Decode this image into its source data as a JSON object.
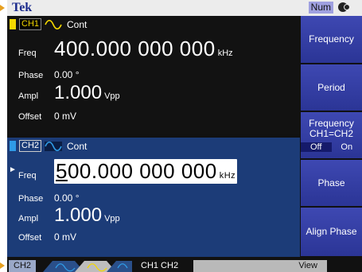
{
  "brand": "Tek",
  "num_indicator": "Num",
  "colors": {
    "ch1": "#f5d800",
    "ch2": "#2f9be6",
    "softkey": "#3a45b0"
  },
  "ch1": {
    "tag": "CH1",
    "mode": "Cont",
    "freq": {
      "label": "Freq",
      "value": "400.000 000 000",
      "unit": "kHz"
    },
    "phase": {
      "label": "Phase",
      "value": "0.00 °"
    },
    "ampl": {
      "label": "Ampl",
      "value": "1.000",
      "unit": "Vpp"
    },
    "offset": {
      "label": "Offset",
      "value": "0 mV"
    }
  },
  "ch2": {
    "tag": "CH2",
    "mode": "Cont",
    "freq": {
      "label": "Freq",
      "value_first": "5",
      "value_rest": "00.000 000 000",
      "unit": "kHz"
    },
    "phase": {
      "label": "Phase",
      "value": "0.00 °"
    },
    "ampl": {
      "label": "Ampl",
      "value": "1.000",
      "unit": "Vpp"
    },
    "offset": {
      "label": "Offset",
      "value": "0 mV"
    }
  },
  "softkeys": {
    "frequency": "Frequency",
    "period": "Period",
    "freq_link_line1": "Frequency",
    "freq_link_line2": "CH1=CH2",
    "off": "Off",
    "on": "On",
    "phase": "Phase",
    "align_phase": "Align Phase"
  },
  "bottom": {
    "tab_ch2": "CH2",
    "tab_ch1ch2": "CH1  CH2",
    "view": "View"
  }
}
